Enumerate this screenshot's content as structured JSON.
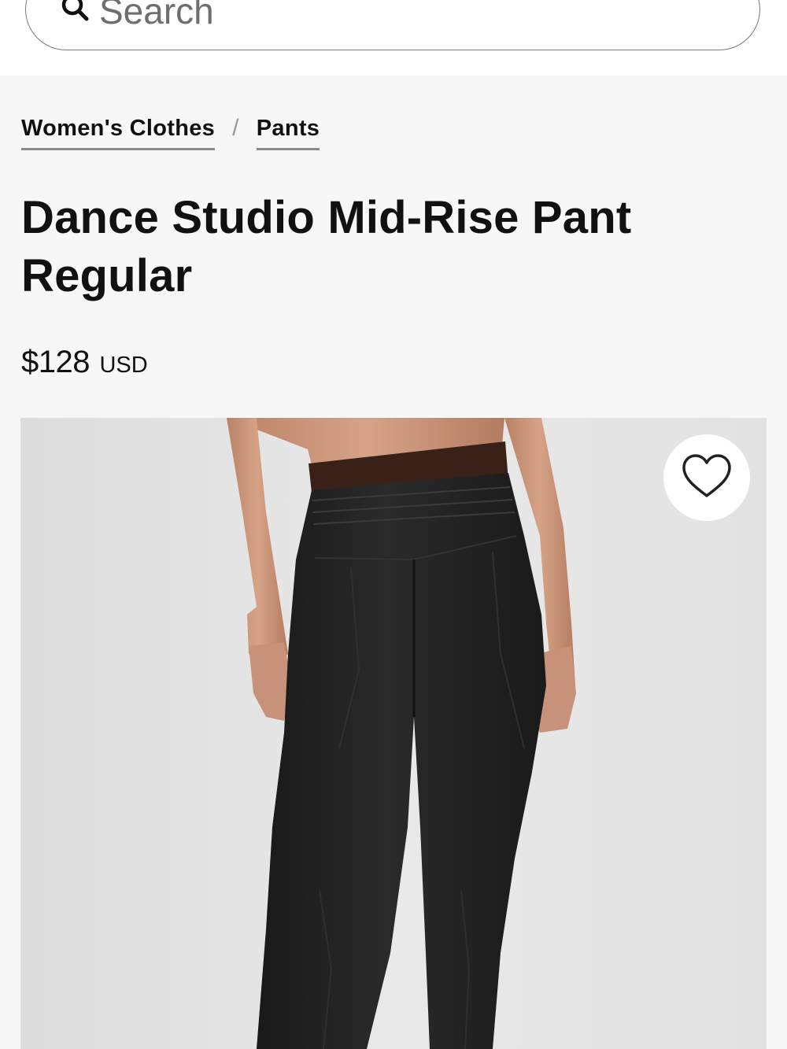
{
  "search": {
    "placeholder": "Search",
    "icon": "search-icon"
  },
  "breadcrumb": {
    "items": [
      {
        "label": "Women's Clothes"
      },
      {
        "label": "Pants"
      }
    ],
    "separator": "/"
  },
  "product": {
    "title_line1": "Dance Studio Mid-Rise Pant",
    "title_line2": "Regular",
    "price": "$128",
    "currency": "USD",
    "wishlist_icon": "heart-icon",
    "image_subject": "back view of black pants",
    "colors": {
      "pants": "#1f1f1f",
      "waistband": "#3a2118",
      "background": "#e6e6e6"
    }
  }
}
